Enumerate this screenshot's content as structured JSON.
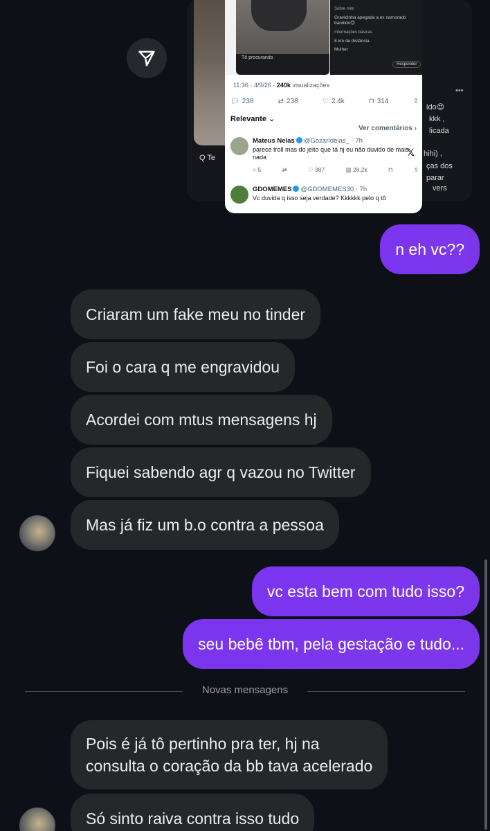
{
  "shared_post": {
    "profile_img_text_1": "Tô procurando",
    "profile_about_label": "Sobre mim",
    "profile_about_text": "Gravidinha apegada a ex namorado bandido😍",
    "profile_info_label": "Informações básicas",
    "profile_distance": "8 km de distância",
    "profile_gender": "Mulher",
    "profile_reply_btn": "Responder",
    "tweet_time": "11:36 · 4/9/26 ·",
    "tweet_views": "240k",
    "tweet_views_label": "visualizações",
    "stats": {
      "replies": "238",
      "retweets": "238",
      "likes": "2.4k",
      "bookmarks": "314"
    },
    "sort_label": "Relevante",
    "see_comments": "Ver comentários",
    "replies": [
      {
        "name": "Mateus Nelas",
        "handle": "@GozarIdeias_ · 7h",
        "text": "parece troll mas do jeito que tá hj eu não duvido de mais nada",
        "replies": "5",
        "likes": "387",
        "views": "28.2k"
      },
      {
        "name": "GDOMEMES",
        "handle": "@GDOMEMES30 · 7h",
        "text": "Vc duvida q isso seja verdade? Kkkkkk pelo q tô"
      }
    ],
    "bg_lines": [
      "ido😍",
      "kkk ,",
      "licada",
      "hihi) ,",
      "ças dos",
      "parar",
      "vers"
    ],
    "bg_search": "Q Te"
  },
  "messages": {
    "m1": "n eh vc??",
    "m2": "Criaram um fake meu no tinder",
    "m3": "Foi o cara q me engravidou",
    "m4": "Acordei com mtus mensagens hj",
    "m5": "Fiquei sabendo agr q vazou no Twitter",
    "m6": "Mas já fiz um b.o contra a pessoa",
    "m7": "vc esta bem com tudo isso?",
    "m8": "seu bebê tbm, pela gestação e tudo...",
    "m9_line1": "Pois é já tô pertinho pra ter, hj na",
    "m9_line2": "consulta o coração da bb tava acelerado",
    "m10": "Só sinto raiva contra isso tudo"
  },
  "separator_label": "Novas mensagens",
  "colors": {
    "sent": "#7a34eb",
    "received": "#25272b",
    "background": "#0d1117"
  }
}
